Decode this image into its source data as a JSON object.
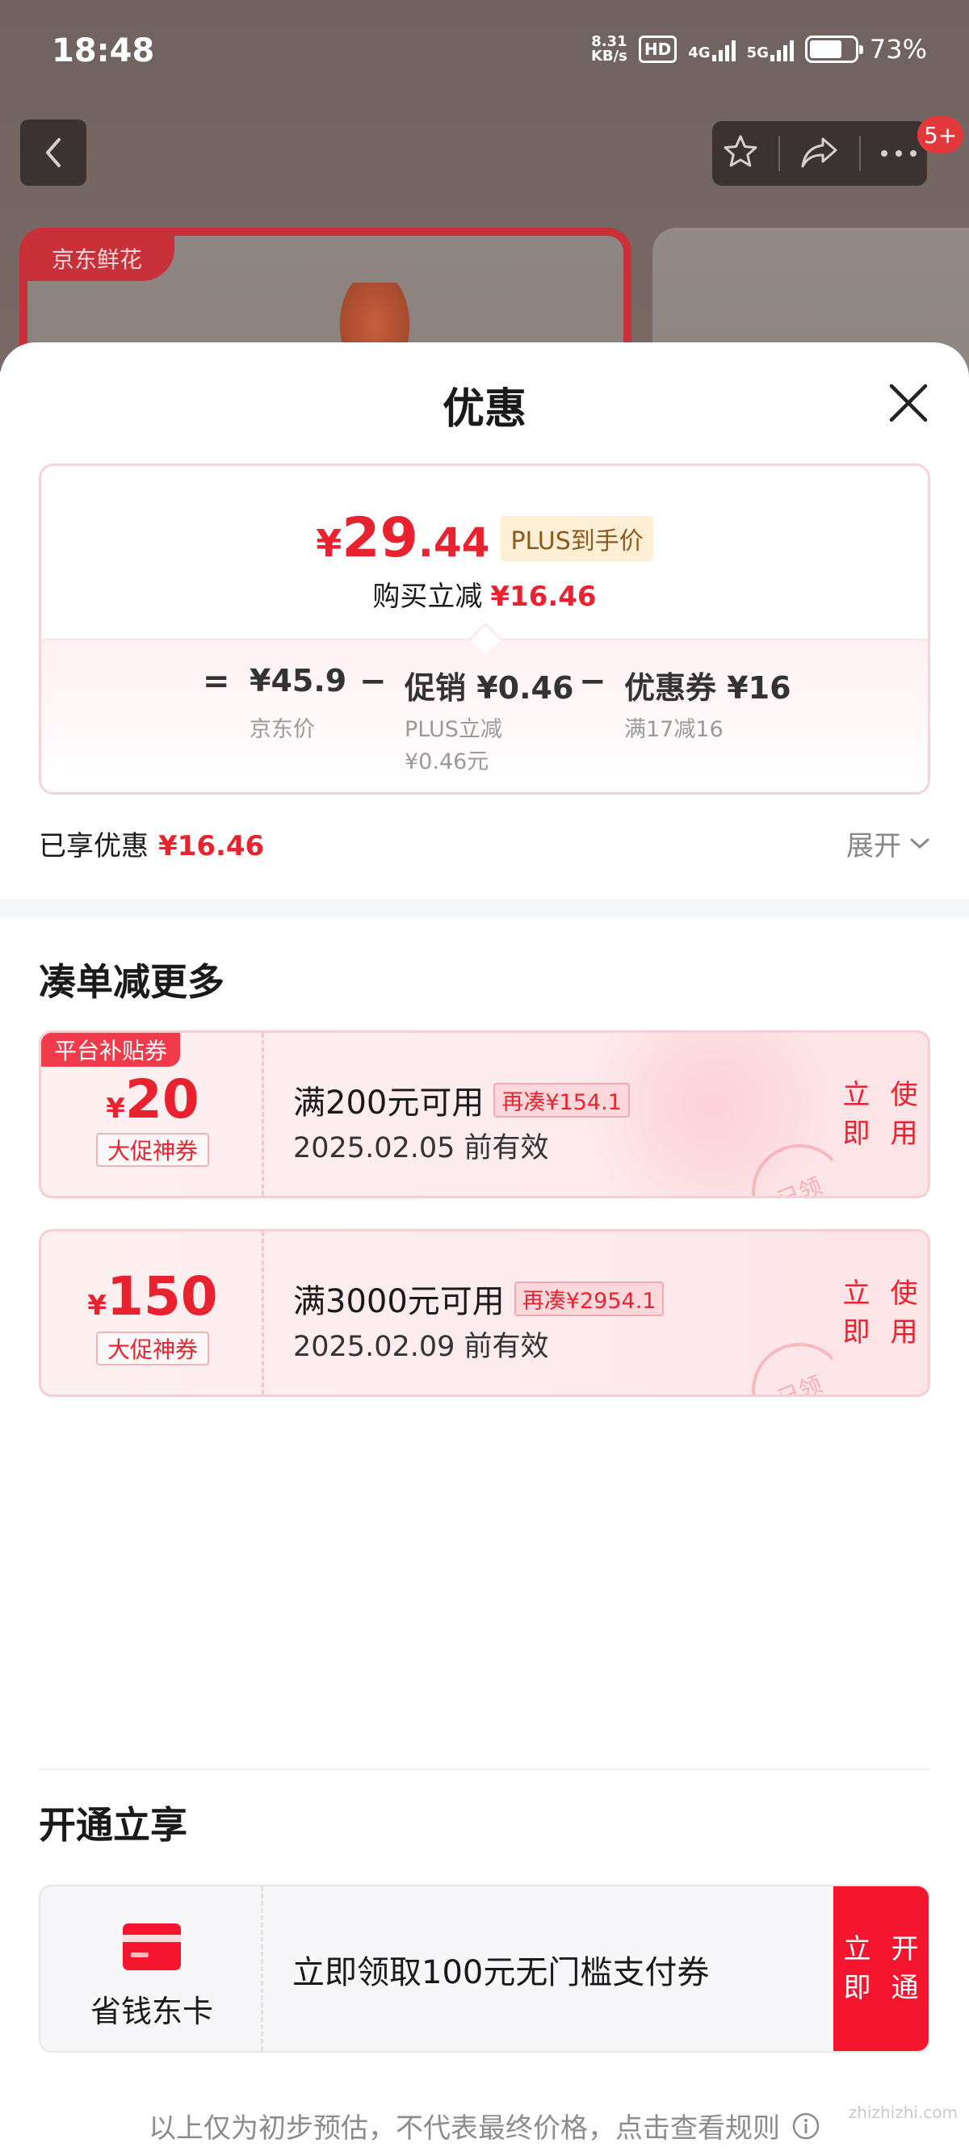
{
  "status_bar": {
    "time": "18:48",
    "net_speed_top": "8.31",
    "net_speed_bottom": "KB/s",
    "hd_label": "HD",
    "signal_1": "4G",
    "signal_2": "5G",
    "battery": "73%"
  },
  "background_page": {
    "notification_badge": "5+",
    "product_tag": "京东鲜花"
  },
  "sheet": {
    "title": "优惠",
    "price_summary": {
      "final_price_symbol": "¥",
      "final_price_int": "29",
      "final_price_dec": ".44",
      "plus_tag": "PLUS到手价",
      "instant_discount_label": "购买立减",
      "instant_discount_value": "¥16.46",
      "formula": {
        "equals": "=",
        "base_price": "¥45.9",
        "base_label": "京东价",
        "minus_1": "−",
        "promo_value": "促销 ¥0.46",
        "promo_label_1": "PLUS立减",
        "promo_label_2": "¥0.46元",
        "minus_2": "−",
        "coupon_value": "优惠券 ¥16",
        "coupon_label": "满17减16"
      }
    },
    "enjoyed_label": "已享优惠",
    "enjoyed_value": "¥16.46",
    "expand_label": "展开",
    "section_more_title": "凑单减更多",
    "coupons": [
      {
        "platform_tag": "平台补贴券",
        "symbol": "¥",
        "amount": "20",
        "badge": "大促神券",
        "condition": "满200元可用",
        "more_needed": "再凑¥154.1",
        "valid_until": "2025.02.05 前有效",
        "button": "立即使用",
        "stamp": "已领"
      },
      {
        "platform_tag": "",
        "symbol": "¥",
        "amount": "150",
        "badge": "大促神券",
        "condition": "满3000元可用",
        "more_needed": "再凑¥2954.1",
        "valid_until": "2025.02.09 前有效",
        "button": "立即使用",
        "stamp": "已领"
      }
    ],
    "section_open_title": "开通立享",
    "membership": {
      "name": "省钱东卡",
      "description": "立即领取100元无门槛支付券",
      "button": "立即开通"
    },
    "disclaimer": "以上仅为初步预估，不代表最终价格，点击查看规则"
  },
  "watermark": "zhizhizhi.com",
  "colors": {
    "accent_red": "#e8232f",
    "button_red": "#f5152e",
    "plus_gold": "#8b5a1c"
  }
}
